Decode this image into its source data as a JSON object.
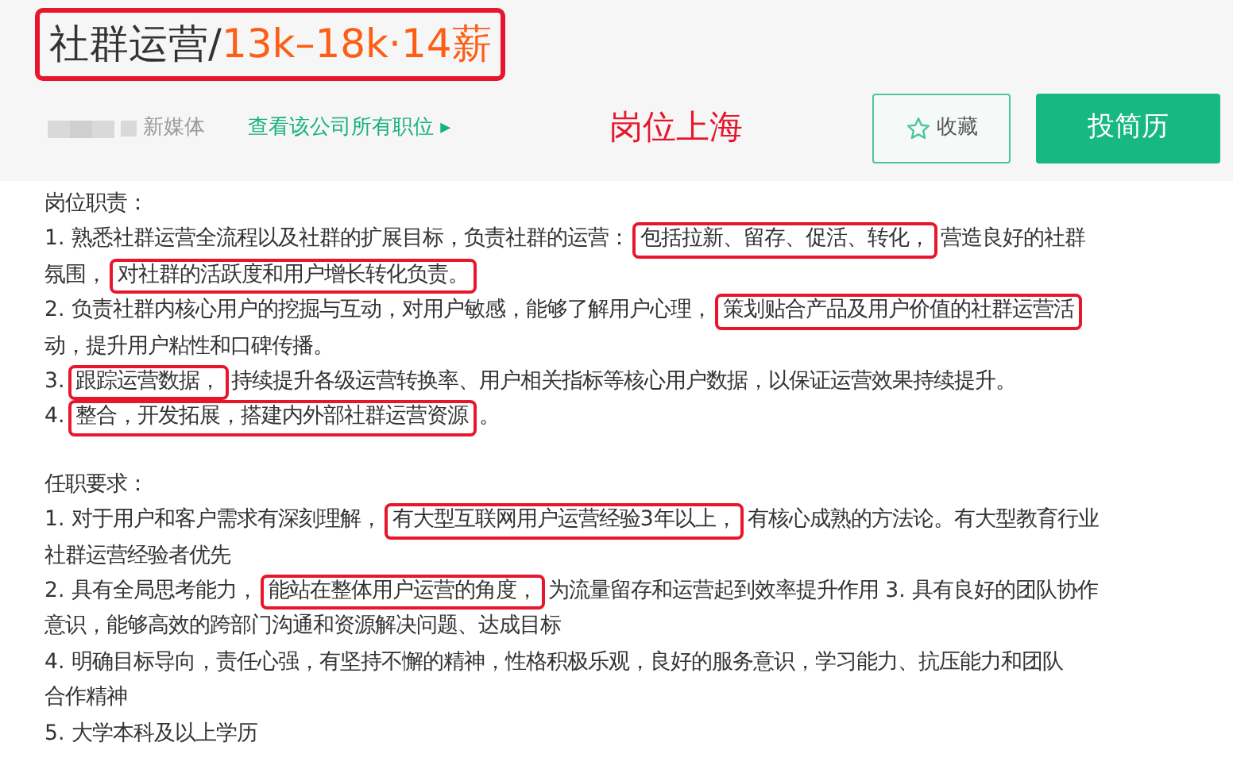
{
  "job": {
    "title": "社群运营",
    "separator": "/",
    "salary": "13k–18k·14薪",
    "title_highlighted": true
  },
  "company": {
    "category": "新媒体",
    "link": "查看该公司所有职位",
    "link_arrow": "▸"
  },
  "annotation": "岗位上海",
  "buttons": [
    {
      "kind": "outline",
      "label": "收藏"
    },
    {
      "kind": "primary",
      "label": "投简历"
    }
  ],
  "sections": [
    {
      "heading": "岗位职责：",
      "lines": [
        [
          {
            "text": "1. 熟悉社群运营全流程以及社群的扩展目标，负责社群的运营：",
            "highlighted": false
          },
          {
            "text": "包括拉新、留存、促活、转化，",
            "highlighted": true
          },
          {
            "text": "营造良好的社群",
            "highlighted": false
          }
        ],
        [
          {
            "text": "氛围，",
            "highlighted": false
          },
          {
            "text": "对社群的活跃度和用户增长转化负责。",
            "highlighted": true
          }
        ],
        [
          {
            "text": "2. 负责社群内核心用户的挖掘与互动，对用户敏感，能够了解用户心理，",
            "highlighted": false
          },
          {
            "text": "策划贴合产品及用户价值的社群运营活",
            "highlighted": true
          }
        ],
        [
          {
            "text": "动，提升用户粘性和口碑传播。",
            "highlighted": false
          }
        ],
        [
          {
            "text": "3.",
            "highlighted": false
          },
          {
            "text": "跟踪运营数据，",
            "highlighted": true
          },
          {
            "text": "持续提升各级运营转换率、用户相关指标等核心用户数据，以保证运营效果持续提升。",
            "highlighted": false
          }
        ],
        [
          {
            "text": "4.",
            "highlighted": false
          },
          {
            "text": "整合，开发拓展，搭建内外部社群运营资源",
            "highlighted": true
          },
          {
            "text": "。",
            "highlighted": false
          }
        ]
      ]
    },
    {
      "heading": "任职要求：",
      "lines": [
        [
          {
            "text": "1. 对于用户和客户需求有深刻理解，",
            "highlighted": false
          },
          {
            "text": "有大型互联网用户运营经验3年以上，",
            "highlighted": true
          },
          {
            "text": "有核心成熟的方法论。有大型教育行业",
            "highlighted": false
          }
        ],
        [
          {
            "text": "社群运营经验者优先",
            "highlighted": false
          }
        ],
        [
          {
            "text": "2. 具有全局思考能力，",
            "highlighted": false
          },
          {
            "text": "能站在整体用户运营的角度，",
            "highlighted": true
          },
          {
            "text": "为流量留存和运营起到效率提升作用 3. 具有良好的团队协作",
            "highlighted": false
          }
        ],
        [
          {
            "text": "意识，能够高效的跨部门沟通和资源解决问题、达成目标",
            "highlighted": false
          }
        ],
        [
          {
            "text": "4. 明确目标导向，责任心强，有坚持不懈的精神，性格积极乐观，良好的服务意识，学习能力、抗压能力和团队",
            "highlighted": false
          }
        ],
        [
          {
            "text": "合作精神",
            "highlighted": false
          }
        ],
        [
          {
            "text": "5. 大学本科及以上学历",
            "highlighted": false
          }
        ]
      ]
    }
  ]
}
